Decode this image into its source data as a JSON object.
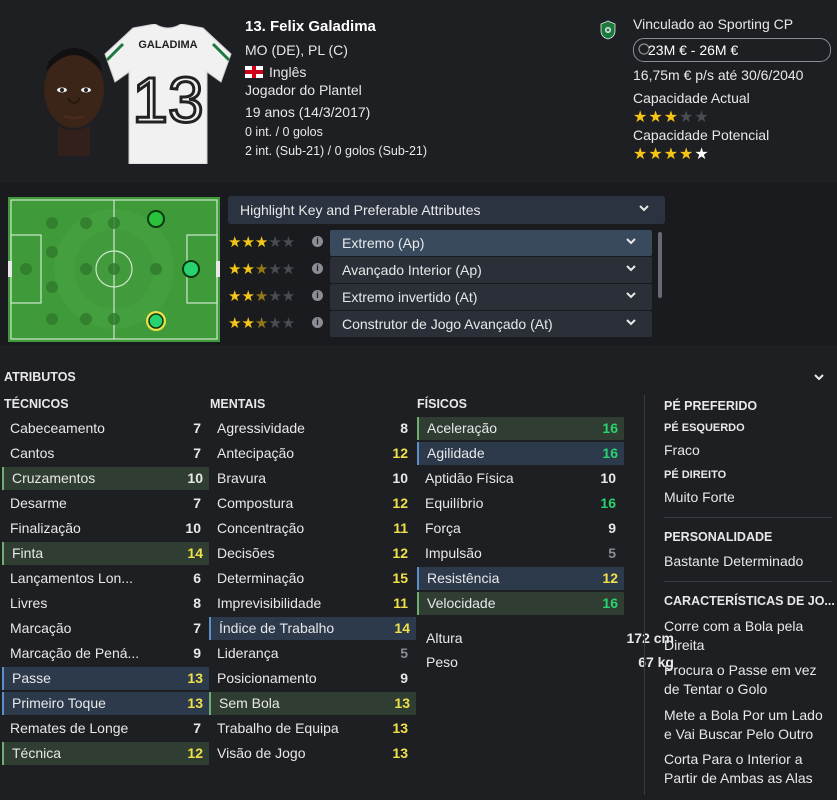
{
  "player": {
    "name": "13. Felix Galadima",
    "positions": "MO (DE), PL (C)",
    "nationality": "Inglês",
    "squad_status": "Jogador do Plantel",
    "age": "19 anos (14/3/2017)",
    "caps": "0 int. / 0 golos",
    "u21_caps": "2 int. (Sub-21) / 0 golos (Sub-21)",
    "shirt_name": "GALADIMA",
    "shirt_number": "13"
  },
  "contract": {
    "club": "Vinculado ao Sporting CP",
    "value": "23M € - 26M €",
    "wage": "16,75m € p/s até 30/6/2040",
    "current_ability_label": "Capacidade Actual",
    "current_ability_stars": 3,
    "potential_ability_label": "Capacidade Potencial",
    "potential_ability_stars": 4.5
  },
  "roles": {
    "highlight_label": "Highlight Key and Preferable Attributes",
    "items": [
      {
        "label": "Extremo (Ap)",
        "stars": 3
      },
      {
        "label": "Avançado Interior (Ap)",
        "stars": 2.5
      },
      {
        "label": "Extremo invertido (At)",
        "stars": 2.5
      },
      {
        "label": "Construtor de Jogo Avançado (At)",
        "stars": 2.5
      }
    ]
  },
  "attributes": {
    "section_title": "ATRIBUTOS",
    "tecnicos": {
      "title": "TÉCNICOS",
      "rows": [
        {
          "name": "Cabeceamento",
          "value": "7",
          "hl": ""
        },
        {
          "name": "Cantos",
          "value": "7",
          "hl": ""
        },
        {
          "name": "Cruzamentos",
          "value": "10",
          "hl": "green"
        },
        {
          "name": "Desarme",
          "value": "7",
          "hl": ""
        },
        {
          "name": "Finalização",
          "value": "10",
          "hl": ""
        },
        {
          "name": "Finta",
          "value": "14",
          "hl": "green"
        },
        {
          "name": "Lançamentos Lon...",
          "value": "6",
          "hl": ""
        },
        {
          "name": "Livres",
          "value": "8",
          "hl": ""
        },
        {
          "name": "Marcação",
          "value": "7",
          "hl": ""
        },
        {
          "name": "Marcação de Pená...",
          "value": "9",
          "hl": ""
        },
        {
          "name": "Passe",
          "value": "13",
          "hl": "blue"
        },
        {
          "name": "Primeiro Toque",
          "value": "13",
          "hl": "blue"
        },
        {
          "name": "Remates de Longe",
          "value": "7",
          "hl": ""
        },
        {
          "name": "Técnica",
          "value": "12",
          "hl": "green"
        }
      ]
    },
    "mentais": {
      "title": "MENTAIS",
      "rows": [
        {
          "name": "Agressividade",
          "value": "8",
          "hl": ""
        },
        {
          "name": "Antecipação",
          "value": "12",
          "hl": ""
        },
        {
          "name": "Bravura",
          "value": "10",
          "hl": ""
        },
        {
          "name": "Compostura",
          "value": "12",
          "hl": ""
        },
        {
          "name": "Concentração",
          "value": "11",
          "hl": ""
        },
        {
          "name": "Decisões",
          "value": "12",
          "hl": ""
        },
        {
          "name": "Determinação",
          "value": "15",
          "hl": ""
        },
        {
          "name": "Imprevisibilidade",
          "value": "11",
          "hl": ""
        },
        {
          "name": "Índice de Trabalho",
          "value": "14",
          "hl": "blue"
        },
        {
          "name": "Liderança",
          "value": "5",
          "hl": ""
        },
        {
          "name": "Posicionamento",
          "value": "9",
          "hl": ""
        },
        {
          "name": "Sem Bola",
          "value": "13",
          "hl": "green"
        },
        {
          "name": "Trabalho de Equipa",
          "value": "13",
          "hl": ""
        },
        {
          "name": "Visão de Jogo",
          "value": "13",
          "hl": ""
        }
      ]
    },
    "fisicos": {
      "title": "FÍSICOS",
      "rows": [
        {
          "name": "Aceleração",
          "value": "16",
          "hl": "green"
        },
        {
          "name": "Agilidade",
          "value": "16",
          "hl": "blue"
        },
        {
          "name": "Aptidão Física",
          "value": "10",
          "hl": ""
        },
        {
          "name": "Equilíbrio",
          "value": "16",
          "hl": ""
        },
        {
          "name": "Força",
          "value": "9",
          "hl": ""
        },
        {
          "name": "Impulsão",
          "value": "5",
          "hl": ""
        },
        {
          "name": "Resistência",
          "value": "12",
          "hl": "blue"
        },
        {
          "name": "Velocidade",
          "value": "16",
          "hl": "green"
        }
      ],
      "height_label": "Altura",
      "height_value": "172 cm",
      "weight_label": "Peso",
      "weight_value": "67 kg"
    }
  },
  "side": {
    "foot_title": "PÉ PREFERIDO",
    "left_label": "PÉ ESQUERDO",
    "left_value": "Fraco",
    "right_label": "PÉ DIREITO",
    "right_value": "Muito Forte",
    "personality_title": "PERSONALIDADE",
    "personality_value": "Bastante Determinado",
    "traits_title": "CARACTERÍSTICAS DE JO...",
    "traits": [
      "Corre com a Bola pela Direita",
      "Procura o Passe em vez de Tentar o Golo",
      "Mete a Bola Por um Lado e Vai Buscar Pelo Outro",
      "Corta Para o Interior a Partir de Ambas as Alas"
    ]
  },
  "colors": {
    "background": "#1e1f22",
    "star": "#f5c518",
    "value_green": "#29d36f",
    "value_yellow": "#f0e04a",
    "value_grey": "#8a8d94",
    "highlight_blue": "#2c3a4c",
    "highlight_green": "#2f3d33"
  }
}
